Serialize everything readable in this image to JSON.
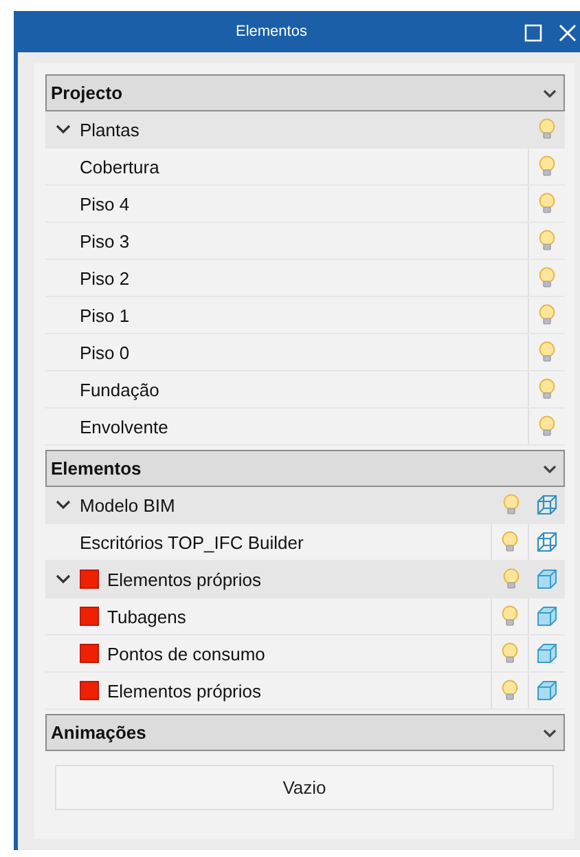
{
  "window": {
    "title": "Elementos"
  },
  "sections": [
    {
      "title": "Projecto",
      "expanded": true,
      "items": [
        {
          "label": "Plantas",
          "expanded": true,
          "children": [
            {
              "label": "Cobertura"
            },
            {
              "label": "Piso 4"
            },
            {
              "label": "Piso 3"
            },
            {
              "label": "Piso 2"
            },
            {
              "label": "Piso 1"
            },
            {
              "label": "Piso 0"
            },
            {
              "label": "Fundação"
            },
            {
              "label": "Envolvente"
            }
          ]
        }
      ]
    },
    {
      "title": "Elementos",
      "expanded": true,
      "items": [
        {
          "label": "Modelo BIM",
          "kind": "model",
          "expanded": true,
          "children": [
            {
              "label": "Escritórios TOP_IFC Builder",
              "kind": "model"
            }
          ]
        },
        {
          "label": "Elementos próprios",
          "kind": "layer",
          "color": "#ee2200",
          "expanded": true,
          "children": [
            {
              "label": "Tubagens",
              "kind": "layer",
              "color": "#ee2200"
            },
            {
              "label": "Pontos de consumo",
              "kind": "layer",
              "color": "#ee2200"
            },
            {
              "label": "Elementos próprios",
              "kind": "layer",
              "color": "#ee2200"
            }
          ]
        }
      ]
    },
    {
      "title": "Animações",
      "expanded": true,
      "empty_text": "Vazio"
    }
  ]
}
